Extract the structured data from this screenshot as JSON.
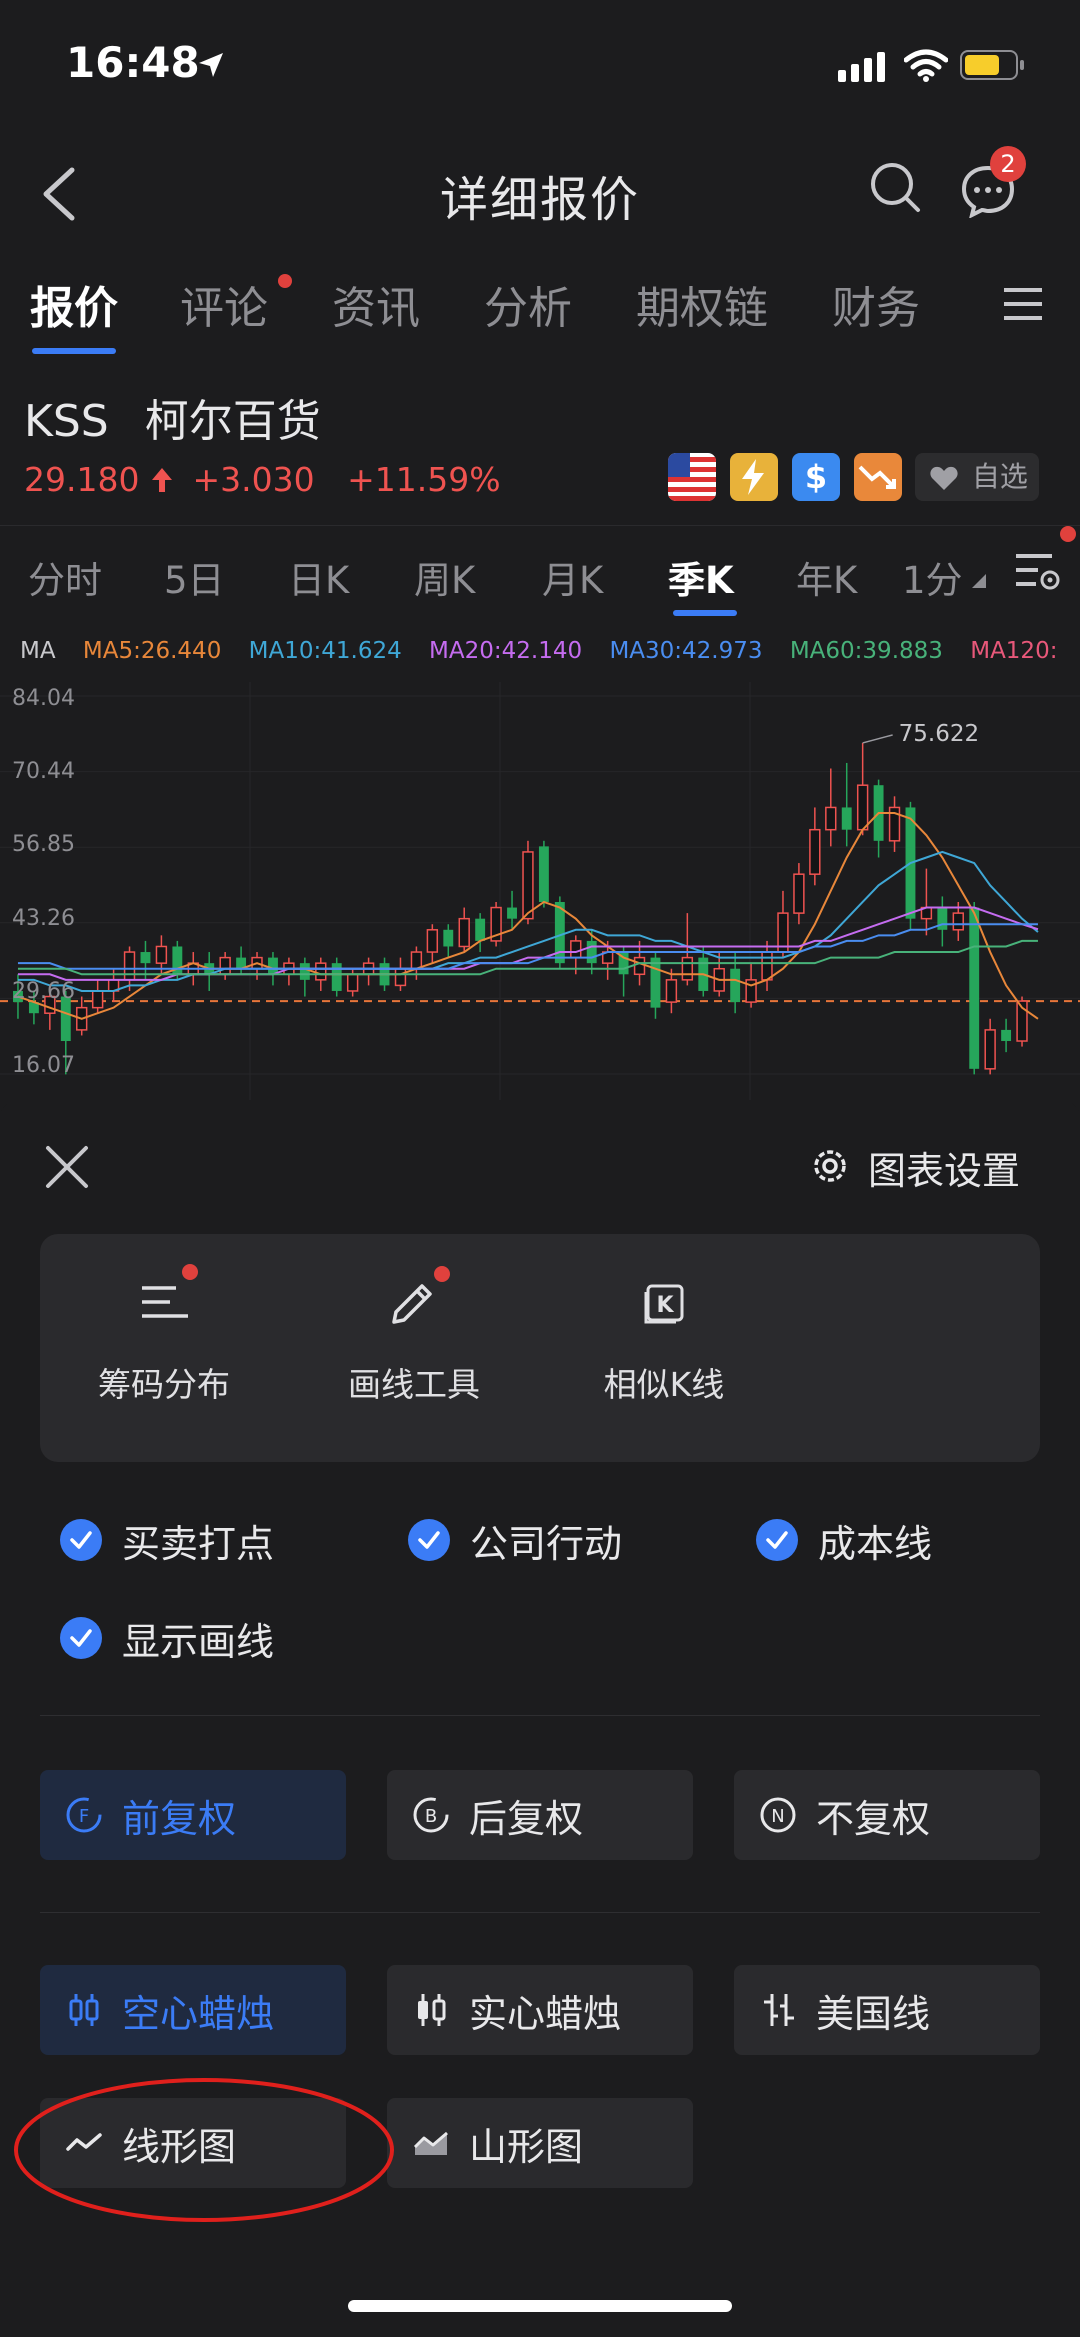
{
  "status_bar": {
    "time": "16:48"
  },
  "nav": {
    "title": "详细报价",
    "message_badge": "2"
  },
  "tabs": [
    {
      "label": "报价",
      "active": true
    },
    {
      "label": "评论",
      "dot": true
    },
    {
      "label": "资讯"
    },
    {
      "label": "分析"
    },
    {
      "label": "期权链"
    },
    {
      "label": "财务"
    }
  ],
  "stock": {
    "ticker": "KSS",
    "name": "柯尔百货",
    "price": "29.180",
    "change": "+3.030",
    "change_pct": "+11.59%",
    "favorite_label": "自选"
  },
  "periods": [
    {
      "label": "分时"
    },
    {
      "label": "5日"
    },
    {
      "label": "日K"
    },
    {
      "label": "周K"
    },
    {
      "label": "月K"
    },
    {
      "label": "季K",
      "active": true
    },
    {
      "label": "年K"
    },
    {
      "label": "1分"
    }
  ],
  "ma": {
    "label": "MA",
    "items": [
      {
        "text": "MA5:26.440",
        "color": "#e8873a"
      },
      {
        "text": "MA10:41.624",
        "color": "#3fa7d6"
      },
      {
        "text": "MA20:42.140",
        "color": "#c56cf0"
      },
      {
        "text": "MA30:42.973",
        "color": "#4a8df0"
      },
      {
        "text": "MA60:39.883",
        "color": "#48b27a"
      },
      {
        "text": "MA120:",
        "color": "#e8587a"
      }
    ]
  },
  "chart_data": {
    "type": "candlestick",
    "y_ticks": [
      "84.04",
      "70.44",
      "56.85",
      "43.26",
      "29.66",
      "16.07"
    ],
    "ylim": [
      16.07,
      84.04
    ],
    "max_label": "75.622",
    "current_price": 29.18,
    "candles": [
      {
        "o": 31,
        "c": 29,
        "h": 34,
        "l": 26
      },
      {
        "o": 29,
        "c": 27,
        "h": 31,
        "l": 25
      },
      {
        "o": 27,
        "c": 30,
        "h": 32,
        "l": 24
      },
      {
        "o": 30,
        "c": 22,
        "h": 31,
        "l": 16
      },
      {
        "o": 24,
        "c": 28,
        "h": 30,
        "l": 23
      },
      {
        "o": 28,
        "c": 31,
        "h": 33,
        "l": 27
      },
      {
        "o": 31,
        "c": 33,
        "h": 35,
        "l": 29
      },
      {
        "o": 33,
        "c": 38,
        "h": 39,
        "l": 31
      },
      {
        "o": 38,
        "c": 36,
        "h": 40,
        "l": 33
      },
      {
        "o": 36,
        "c": 39,
        "h": 41,
        "l": 34
      },
      {
        "o": 39,
        "c": 34,
        "h": 40,
        "l": 33
      },
      {
        "o": 34,
        "c": 36,
        "h": 38,
        "l": 32
      },
      {
        "o": 36,
        "c": 34,
        "h": 38,
        "l": 31
      },
      {
        "o": 34,
        "c": 37,
        "h": 38,
        "l": 33
      },
      {
        "o": 37,
        "c": 35,
        "h": 39,
        "l": 34
      },
      {
        "o": 35,
        "c": 37,
        "h": 38,
        "l": 33
      },
      {
        "o": 37,
        "c": 34,
        "h": 38,
        "l": 32
      },
      {
        "o": 34,
        "c": 36,
        "h": 37,
        "l": 32
      },
      {
        "o": 36,
        "c": 33,
        "h": 37,
        "l": 30
      },
      {
        "o": 33,
        "c": 36,
        "h": 37,
        "l": 31
      },
      {
        "o": 36,
        "c": 31,
        "h": 37,
        "l": 30
      },
      {
        "o": 31,
        "c": 34,
        "h": 35,
        "l": 30
      },
      {
        "o": 34,
        "c": 36,
        "h": 37,
        "l": 32
      },
      {
        "o": 36,
        "c": 32,
        "h": 37,
        "l": 31
      },
      {
        "o": 32,
        "c": 35,
        "h": 37,
        "l": 31
      },
      {
        "o": 35,
        "c": 38,
        "h": 39,
        "l": 33
      },
      {
        "o": 38,
        "c": 42,
        "h": 43,
        "l": 36
      },
      {
        "o": 42,
        "c": 39,
        "h": 43,
        "l": 37
      },
      {
        "o": 39,
        "c": 44,
        "h": 46,
        "l": 38
      },
      {
        "o": 44,
        "c": 40,
        "h": 45,
        "l": 38
      },
      {
        "o": 40,
        "c": 46,
        "h": 47,
        "l": 39
      },
      {
        "o": 46,
        "c": 44,
        "h": 49,
        "l": 42
      },
      {
        "o": 44,
        "c": 56,
        "h": 58,
        "l": 43
      },
      {
        "o": 57,
        "c": 47,
        "h": 58,
        "l": 46
      },
      {
        "o": 47,
        "c": 36,
        "h": 48,
        "l": 35
      },
      {
        "o": 37,
        "c": 40,
        "h": 41,
        "l": 34
      },
      {
        "o": 40,
        "c": 36,
        "h": 42,
        "l": 34
      },
      {
        "o": 36,
        "c": 38,
        "h": 40,
        "l": 33
      },
      {
        "o": 38,
        "c": 34,
        "h": 39,
        "l": 30
      },
      {
        "o": 34,
        "c": 37,
        "h": 40,
        "l": 32
      },
      {
        "o": 37,
        "c": 28,
        "h": 38,
        "l": 26
      },
      {
        "o": 29,
        "c": 33,
        "h": 35,
        "l": 27
      },
      {
        "o": 33,
        "c": 37,
        "h": 45,
        "l": 32
      },
      {
        "o": 37,
        "c": 31,
        "h": 39,
        "l": 30
      },
      {
        "o": 31,
        "c": 35,
        "h": 38,
        "l": 30
      },
      {
        "o": 35,
        "c": 29,
        "h": 38,
        "l": 27
      },
      {
        "o": 29,
        "c": 33,
        "h": 36,
        "l": 28
      },
      {
        "o": 33,
        "c": 38,
        "h": 40,
        "l": 31
      },
      {
        "o": 38,
        "c": 45,
        "h": 49,
        "l": 37
      },
      {
        "o": 45,
        "c": 52,
        "h": 54,
        "l": 43
      },
      {
        "o": 52,
        "c": 60,
        "h": 64,
        "l": 50
      },
      {
        "o": 60,
        "c": 64,
        "h": 71,
        "l": 57
      },
      {
        "o": 64,
        "c": 60,
        "h": 72,
        "l": 57
      },
      {
        "o": 60,
        "c": 68,
        "h": 75.6,
        "l": 59
      },
      {
        "o": 68,
        "c": 58,
        "h": 69,
        "l": 55
      },
      {
        "o": 58,
        "c": 64,
        "h": 66,
        "l": 56
      },
      {
        "o": 64,
        "c": 44,
        "h": 65,
        "l": 42
      },
      {
        "o": 44,
        "c": 46,
        "h": 53,
        "l": 41
      },
      {
        "o": 46,
        "c": 42,
        "h": 48,
        "l": 39
      },
      {
        "o": 42,
        "c": 45,
        "h": 47,
        "l": 40
      },
      {
        "o": 46,
        "c": 17,
        "h": 47,
        "l": 16
      },
      {
        "o": 17,
        "c": 24,
        "h": 26,
        "l": 16
      },
      {
        "o": 24,
        "c": 22,
        "h": 26,
        "l": 20
      },
      {
        "o": 22,
        "c": 29.18,
        "h": 30,
        "l": 21
      }
    ],
    "series": [
      {
        "name": "MA5",
        "color": "#e8873a",
        "values": [
          30,
          29,
          28,
          27,
          26,
          27,
          28,
          30,
          32,
          34,
          35,
          36,
          35,
          35,
          35,
          36,
          35,
          35,
          35,
          34,
          34,
          34,
          34,
          34,
          34,
          35,
          36,
          37,
          38,
          40,
          41,
          42,
          45,
          47,
          46,
          44,
          41,
          39,
          37,
          36,
          35,
          34,
          34,
          34,
          33,
          33,
          32,
          33,
          35,
          38,
          43,
          49,
          55,
          60,
          63,
          63,
          62,
          59,
          55,
          50,
          45,
          38,
          32,
          28,
          26
        ]
      },
      {
        "name": "MA10",
        "color": "#3fa7d6",
        "values": [
          33,
          33,
          32,
          32,
          31,
          31,
          31,
          32,
          32,
          33,
          33,
          34,
          34,
          35,
          35,
          35,
          35,
          35,
          35,
          35,
          35,
          35,
          35,
          35,
          35,
          35,
          35,
          36,
          36,
          37,
          37,
          38,
          39,
          40,
          41,
          42,
          42,
          41,
          41,
          41,
          40,
          40,
          39,
          38,
          37,
          37,
          37,
          37,
          37,
          38,
          39,
          41,
          44,
          47,
          50,
          52,
          54,
          55,
          56,
          55,
          54,
          50,
          47,
          44,
          41.6
        ]
      },
      {
        "name": "MA20",
        "color": "#c56cf0",
        "values": [
          34,
          34,
          34,
          33,
          33,
          33,
          33,
          33,
          33,
          33,
          34,
          34,
          34,
          34,
          34,
          34,
          34,
          35,
          35,
          35,
          35,
          35,
          35,
          35,
          35,
          35,
          35,
          35,
          35,
          36,
          36,
          36,
          37,
          37,
          38,
          38,
          39,
          39,
          39,
          39,
          39,
          39,
          39,
          39,
          39,
          39,
          39,
          39,
          39,
          39,
          40,
          40,
          41,
          42,
          43,
          44,
          45,
          46,
          46,
          46,
          46,
          45,
          44,
          43,
          42.1
        ]
      },
      {
        "name": "MA30",
        "color": "#4a8df0",
        "values": [
          36,
          36,
          36,
          35,
          35,
          35,
          35,
          35,
          35,
          35,
          35,
          35,
          35,
          35,
          35,
          35,
          35,
          35,
          35,
          35,
          35,
          35,
          35,
          35,
          35,
          35,
          35,
          35,
          36,
          36,
          36,
          36,
          36,
          37,
          37,
          37,
          37,
          38,
          38,
          38,
          38,
          38,
          38,
          38,
          38,
          38,
          38,
          38,
          38,
          38,
          39,
          39,
          40,
          40,
          41,
          41,
          42,
          42,
          43,
          43,
          43,
          43,
          43,
          43,
          43
        ]
      },
      {
        "name": "MA60",
        "color": "#48b27a",
        "values": [
          35,
          35,
          35,
          35,
          34,
          34,
          34,
          34,
          34,
          34,
          34,
          34,
          34,
          34,
          34,
          34,
          34,
          34,
          34,
          34,
          34,
          34,
          34,
          34,
          34,
          34,
          34,
          34,
          34,
          34,
          35,
          35,
          35,
          35,
          35,
          35,
          35,
          35,
          35,
          36,
          36,
          36,
          36,
          36,
          36,
          36,
          36,
          36,
          36,
          36,
          36,
          37,
          37,
          37,
          37,
          38,
          38,
          38,
          38,
          38,
          39,
          39,
          39,
          40,
          40
        ]
      }
    ]
  },
  "sheet": {
    "settings_label": "图表设置",
    "tools": [
      {
        "label": "筹码分布",
        "icon": "chip-distribution-icon",
        "dot": true
      },
      {
        "label": "画线工具",
        "icon": "pen-icon",
        "dot": true
      },
      {
        "label": "相似K线",
        "icon": "k-line-icon",
        "dot": false
      }
    ],
    "checks": [
      {
        "label": "买卖打点",
        "checked": true
      },
      {
        "label": "公司行动",
        "checked": true
      },
      {
        "label": "成本线",
        "checked": true
      },
      {
        "label": "显示画线",
        "checked": true
      }
    ],
    "adjust": [
      {
        "label": "前复权",
        "icon": "F",
        "active": true
      },
      {
        "label": "后复权",
        "icon": "B",
        "active": false
      },
      {
        "label": "不复权",
        "icon": "N",
        "active": false
      }
    ],
    "styles": [
      {
        "label": "空心蜡烛",
        "active": true
      },
      {
        "label": "实心蜡烛",
        "active": false
      },
      {
        "label": "美国线",
        "active": false
      },
      {
        "label": "线形图",
        "active": false
      },
      {
        "label": "山形图",
        "active": false
      }
    ]
  }
}
